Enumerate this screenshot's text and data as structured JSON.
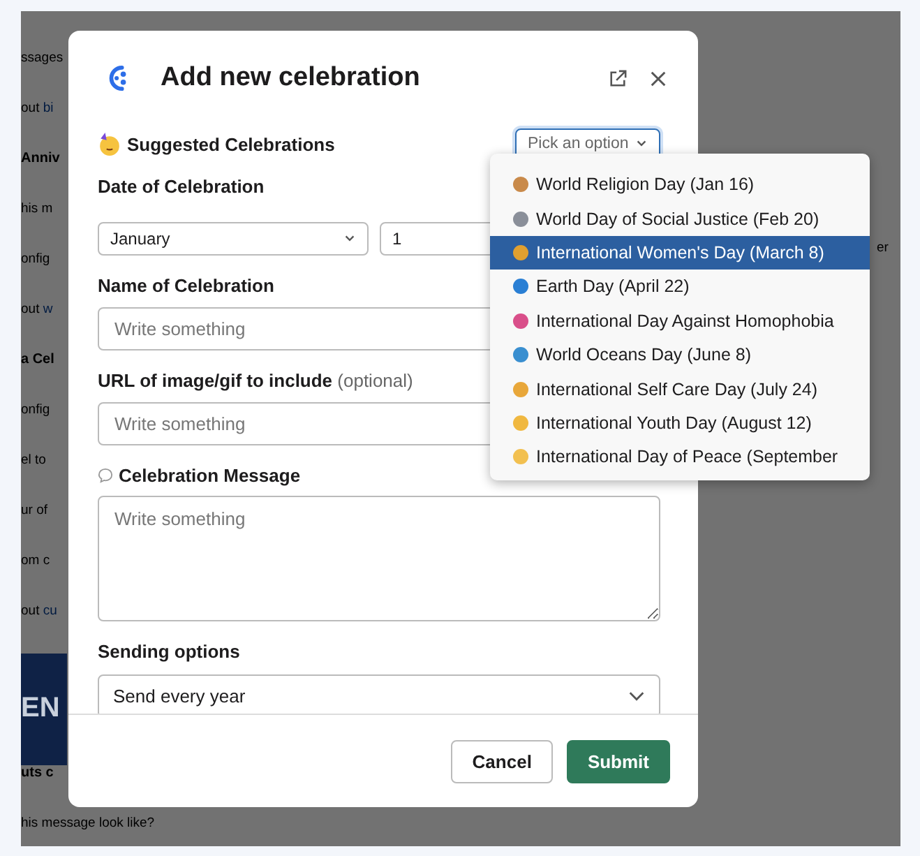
{
  "background": {
    "fragments": [
      {
        "kind": "text",
        "text": "ssages"
      },
      {
        "kind": "text",
        "text": "out ",
        "link": "bi"
      },
      {
        "kind": "heading",
        "text": "Anniv"
      },
      {
        "kind": "text",
        "text": "his m"
      },
      {
        "kind": "text",
        "text": "onfig"
      },
      {
        "kind": "text",
        "text": "out ",
        "link": "w"
      },
      {
        "kind": "heading",
        "text": "a Cel"
      },
      {
        "kind": "text",
        "text": "onfig"
      },
      {
        "kind": "text",
        "text": "el to"
      },
      {
        "kind": "text",
        "text": "ur of"
      },
      {
        "kind": "text",
        "text": "om c"
      },
      {
        "kind": "text",
        "text": "out ",
        "link": "cu"
      },
      {
        "kind": "banner",
        "text": "EN"
      },
      {
        "kind": "heading",
        "text": "uts c"
      },
      {
        "kind": "text",
        "text": "his message look like?"
      }
    ],
    "right_fragment": "er"
  },
  "dialog": {
    "title": "Add new celebration",
    "suggested": {
      "label": "Suggested Celebrations",
      "placeholder": "Pick an option",
      "expanded": true,
      "options": [
        {
          "label": "World Religion Day (Jan 16)",
          "selected": false
        },
        {
          "label": "World Day of Social Justice (Feb 20)",
          "selected": false
        },
        {
          "label": "International Women's Day (March 8)",
          "selected": true
        },
        {
          "label": "Earth Day (April 22)",
          "selected": false
        },
        {
          "label": "International Day Against Homophobia",
          "selected": false
        },
        {
          "label": "World Oceans Day (June 8)",
          "selected": false
        },
        {
          "label": "International Self Care Day (July 24)",
          "selected": false
        },
        {
          "label": "International Youth Day (August 12)",
          "selected": false
        },
        {
          "label": "International Day of Peace (September",
          "selected": false
        }
      ]
    },
    "date": {
      "label": "Date of Celebration",
      "month": "January",
      "day": "1"
    },
    "name": {
      "label": "Name of Celebration",
      "placeholder": "Write something"
    },
    "url": {
      "label": "URL of image/gif to include",
      "hint": "(optional)",
      "placeholder": "Write something"
    },
    "message": {
      "label": "Celebration Message",
      "placeholder": "Write something"
    },
    "sending": {
      "label": "Sending options",
      "value": "Send every year"
    },
    "buttons": {
      "cancel": "Cancel",
      "submit": "Submit"
    }
  }
}
